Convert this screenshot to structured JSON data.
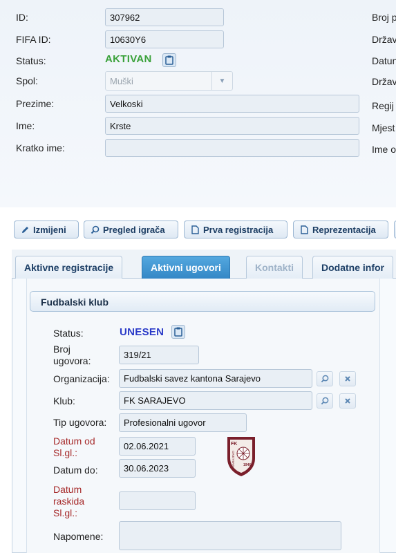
{
  "player": {
    "id_label": "ID:",
    "id_value": "307962",
    "fifa_label": "FIFA ID:",
    "fifa_value": "10630Y6",
    "status_label": "Status:",
    "status_value": "AKTIVAN",
    "spol_label": "Spol:",
    "spol_value": "Muški",
    "prezime_label": "Prezime:",
    "prezime_value": "Velkoski",
    "ime_label": "Ime:",
    "ime_value": "Krste",
    "kratko_label": "Kratko ime:",
    "kratko_value": ""
  },
  "right_column": {
    "labels": [
      "Broj p",
      "Držav",
      "Datun",
      "Držav",
      "Regij",
      "Mjest",
      "Ime o"
    ]
  },
  "toolbar": {
    "izmijeni": "Izmijeni",
    "pregled": "Pregled igrača",
    "prva": "Prva registracija",
    "reprezentacija": "Reprezentacija"
  },
  "tabs": [
    {
      "label": "Aktivne registracije",
      "state": "normal"
    },
    {
      "label": "Aktivni ugovori",
      "state": "active"
    },
    {
      "label": "Kontakti",
      "state": "disabled"
    },
    {
      "label": "Dodatne infor",
      "state": "normal"
    }
  ],
  "contract": {
    "section_title": "Fudbalski klub",
    "status_label": "Status:",
    "status_value": "UNESEN",
    "broj_label_line1": "Broj",
    "broj_label_line2": "ugovora:",
    "broj_value": "319/21",
    "organizacija_label": "Organizacija:",
    "organizacija_value": "Fudbalski savez kantona Sarajevo",
    "klub_label": "Klub:",
    "klub_value": "FK SARAJEVO",
    "tip_label": "Tip ugovora:",
    "tip_value": "Profesionalni ugovor",
    "datum_od_line1": "Datum od",
    "datum_od_line2": "Sl.gl.:",
    "datum_od_value": "02.06.2021",
    "datum_do_label": "Datum do:",
    "datum_do_value": "30.06.2023",
    "raskida_line1": "Datum",
    "raskida_line2": "raskida",
    "raskida_line3": "Sl.gl.:",
    "raskida_value": "",
    "napomene_label": "Napomene:",
    "napomene_value": ""
  },
  "club_logo": {
    "top_text": "FK",
    "side_text": "SARAJEVO",
    "year": "1946",
    "color": "#7a1f2b"
  },
  "colors": {
    "status_active": "#3aa13a",
    "status_unesen": "#2a3ac8",
    "label_required": "#a62a2a",
    "tab_active": "#3487c6"
  }
}
